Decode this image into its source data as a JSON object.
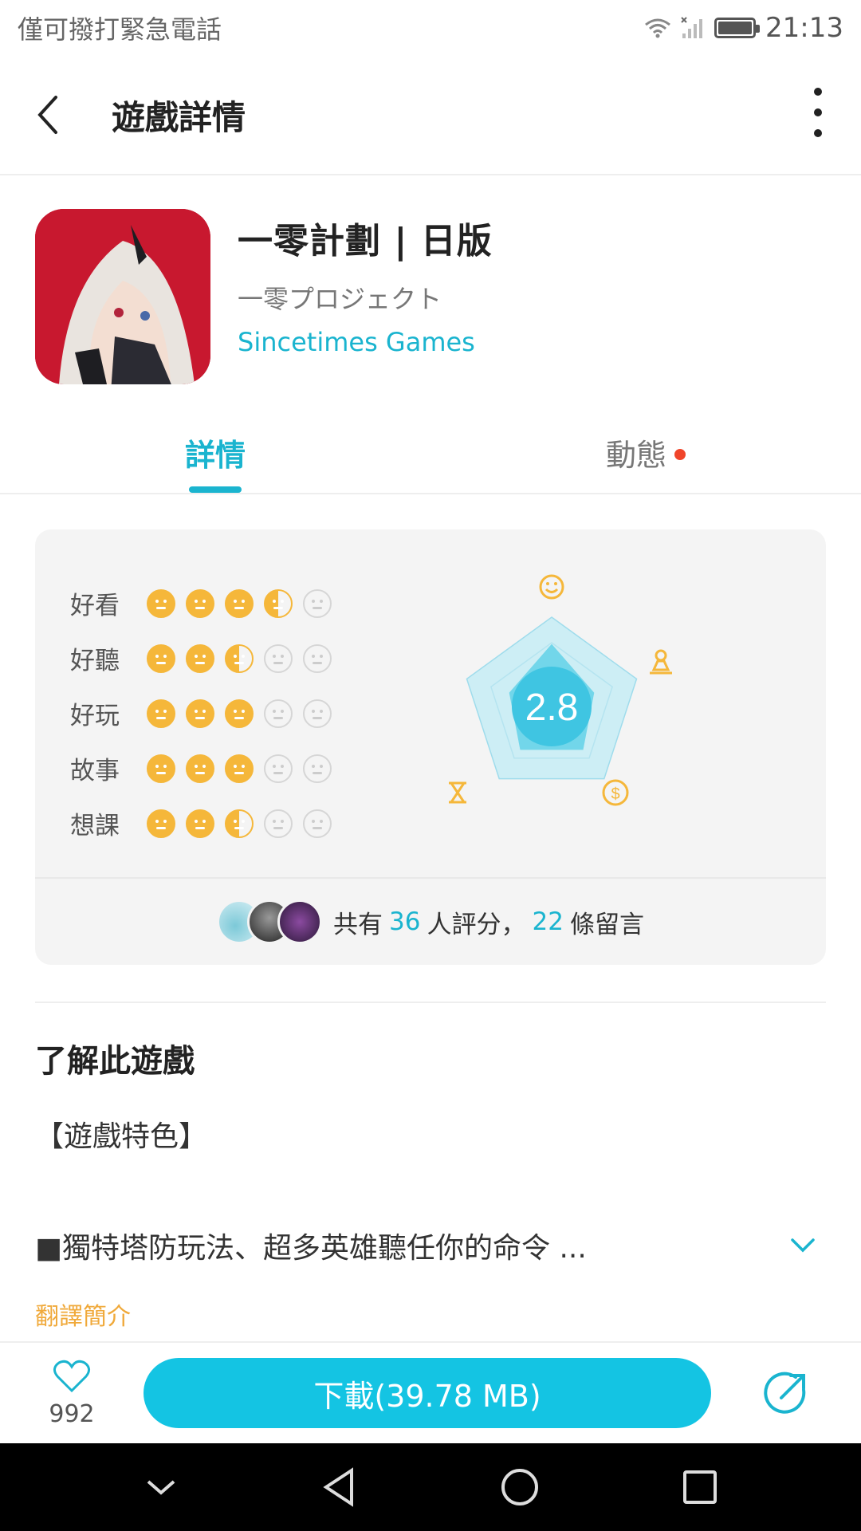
{
  "status": {
    "carrier": "僅可撥打緊急電話",
    "time": "21:13"
  },
  "header": {
    "title": "遊戲詳情"
  },
  "app": {
    "name": "一零計劃 | 日版",
    "subtitle": "一零プロジェクト",
    "developer": "Sincetimes Games"
  },
  "tabs": [
    {
      "label": "詳情"
    },
    {
      "label": "動態"
    }
  ],
  "rating": {
    "score": "2.8",
    "categories": [
      {
        "label": "好看",
        "value": 3.5
      },
      {
        "label": "好聽",
        "value": 2.5
      },
      {
        "label": "好玩",
        "value": 3
      },
      {
        "label": "故事",
        "value": 3
      },
      {
        "label": "想課",
        "value": 2.5
      }
    ],
    "footer": {
      "prefix": "共有",
      "raters": "36",
      "mid": "人評分，",
      "comments": "22",
      "suffix": "條留言"
    }
  },
  "about": {
    "title": "了解此遊戲",
    "feature_heading": "【遊戲特色】",
    "description": "■獨特塔防玩法、超多英雄聽任你的命令 ...",
    "translate": "翻譯簡介"
  },
  "bottom": {
    "likes": "992",
    "download_label": "下載(39.78 MB)"
  },
  "colors": {
    "accent": "#1ab4cf",
    "star": "#f5b73a",
    "button": "#14c4e3",
    "badge": "#f0452a"
  }
}
